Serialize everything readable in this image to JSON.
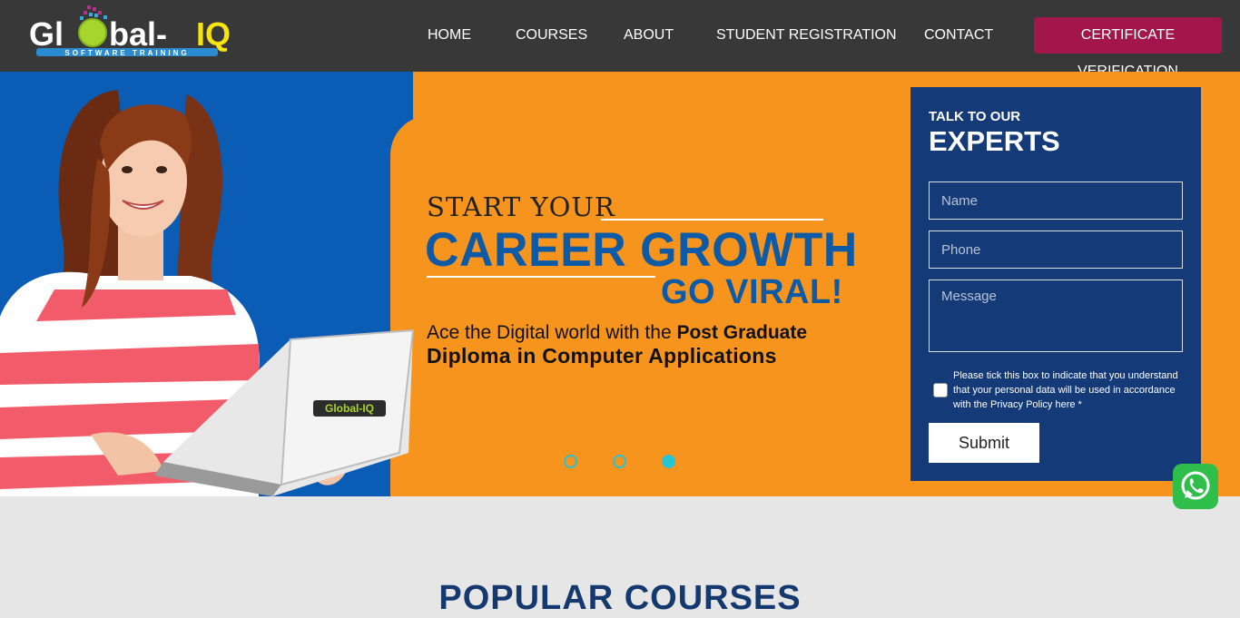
{
  "header": {
    "logo_text": "Global-IQ",
    "logo_tagline": "SOFTWARE TRAINING",
    "nav": [
      {
        "label": "HOME"
      },
      {
        "label": "COURSES"
      },
      {
        "label": "ABOUT"
      },
      {
        "label": "STUDENT REGISTRATION"
      },
      {
        "label": "CONTACT"
      }
    ],
    "cta_label": "CERTIFICATE VERIFICATION"
  },
  "hero": {
    "start": "START YOUR",
    "career": "CAREER GROWTH",
    "viral": "GO VIRAL!",
    "ace_prefix": "Ace the Digital world with the ",
    "ace_bold": "Post Graduate",
    "diploma": "Diploma in Computer Applications",
    "laptop_logo": "Global-IQ",
    "slides": 3,
    "active_slide": 3
  },
  "form": {
    "talk": "TALK TO OUR",
    "experts": "EXPERTS",
    "name_placeholder": "Name",
    "phone_placeholder": "Phone",
    "message_placeholder": "Message",
    "consent": "Please tick this box to indicate that you understand that your personal data will be used in accordance with the Privacy Policy here *",
    "submit": "Submit"
  },
  "whatsapp": {
    "icon": "whatsapp-icon"
  },
  "section": {
    "title": "POPULAR COURSES"
  },
  "colors": {
    "header_bg": "#383838",
    "cta_bg": "#a3164b",
    "hero_orange": "#f7941d",
    "hero_blue": "#0a5cb5",
    "form_bg": "#143a78",
    "headline_blue": "#0d5aa7",
    "dot_cyan": "#27c4d6",
    "whatsapp_green": "#2fbe4a"
  }
}
